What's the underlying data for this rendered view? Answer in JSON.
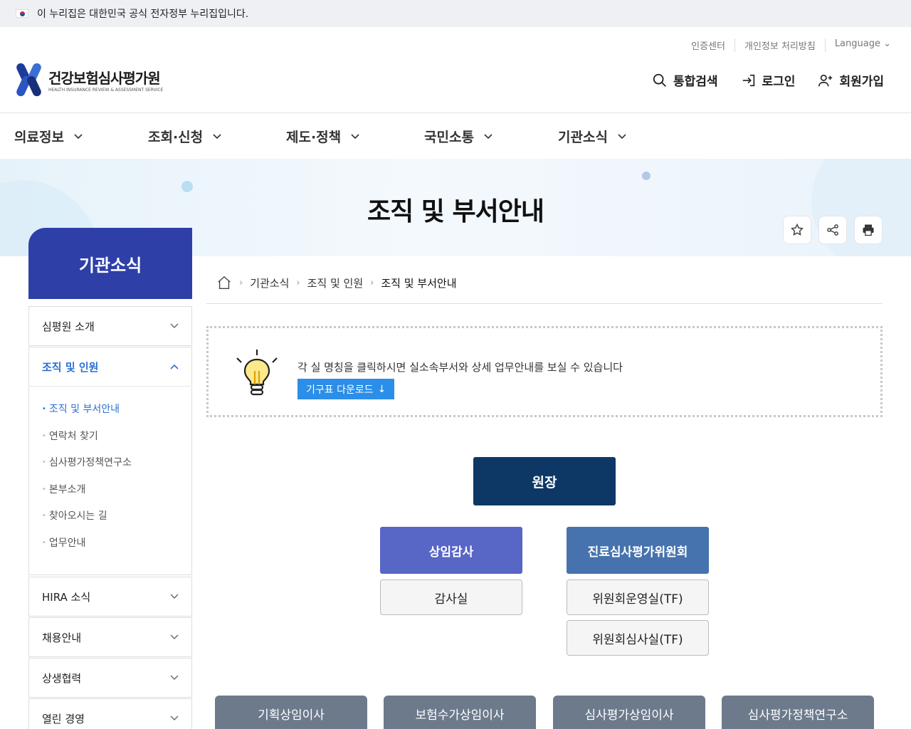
{
  "gov_bar": {
    "text": "이 누리집은 대한민국 공식 전자정부 누리집입니다."
  },
  "logo": {
    "name_ko": "건강보험심사평가원",
    "name_en": "HEALTH INSURANCE REVIEW & ASSESSMENT SERVICE"
  },
  "util_links": [
    "인증센터",
    "개인정보 처리방침",
    "Language"
  ],
  "actions": {
    "search": "통합검색",
    "login": "로그인",
    "signup": "회원가입"
  },
  "gnb": [
    "의료정보",
    "조회·신청",
    "제도·정책",
    "국민소통",
    "기관소식"
  ],
  "page_title": "조직 및 부서안내",
  "lnb": {
    "title": "기관소식",
    "items": [
      "심평원 소개",
      "조직 및 인원",
      "HIRA 소식",
      "채용안내",
      "상생협력",
      "열린 경영"
    ],
    "sub_items": [
      "조직 및 부서안내",
      "연락처 찾기",
      "심사평가정책연구소",
      "본부소개",
      "찾아오시는 길",
      "업무안내"
    ]
  },
  "breadcrumb": [
    "기관소식",
    "조직 및 인원",
    "조직 및 부서안내"
  ],
  "notice": {
    "message": "각 실 명칭을 클릭하시면 실소속부서와 상세 업무안내를 보실 수 있습니다",
    "download": "기구표 다운로드"
  },
  "org": {
    "head": "원장",
    "auditor": "상임감사",
    "audit_office": "감사실",
    "committee": "진료심사평가위원회",
    "committee_ops": "위원회운영실(TF)",
    "committee_review": "위원회심사실(TF)",
    "directors": [
      "기획상임이사",
      "보험수가상임이사",
      "심사평가상임이사",
      "심사평가정책연구소"
    ]
  },
  "colors": {
    "primary": "#2f3fa8",
    "accent": "#2a6fd6",
    "org_head": "#0d3866",
    "org_blue": "#5866c6",
    "org_steel": "#4673ad",
    "org_gray": "#6c7a8c"
  }
}
